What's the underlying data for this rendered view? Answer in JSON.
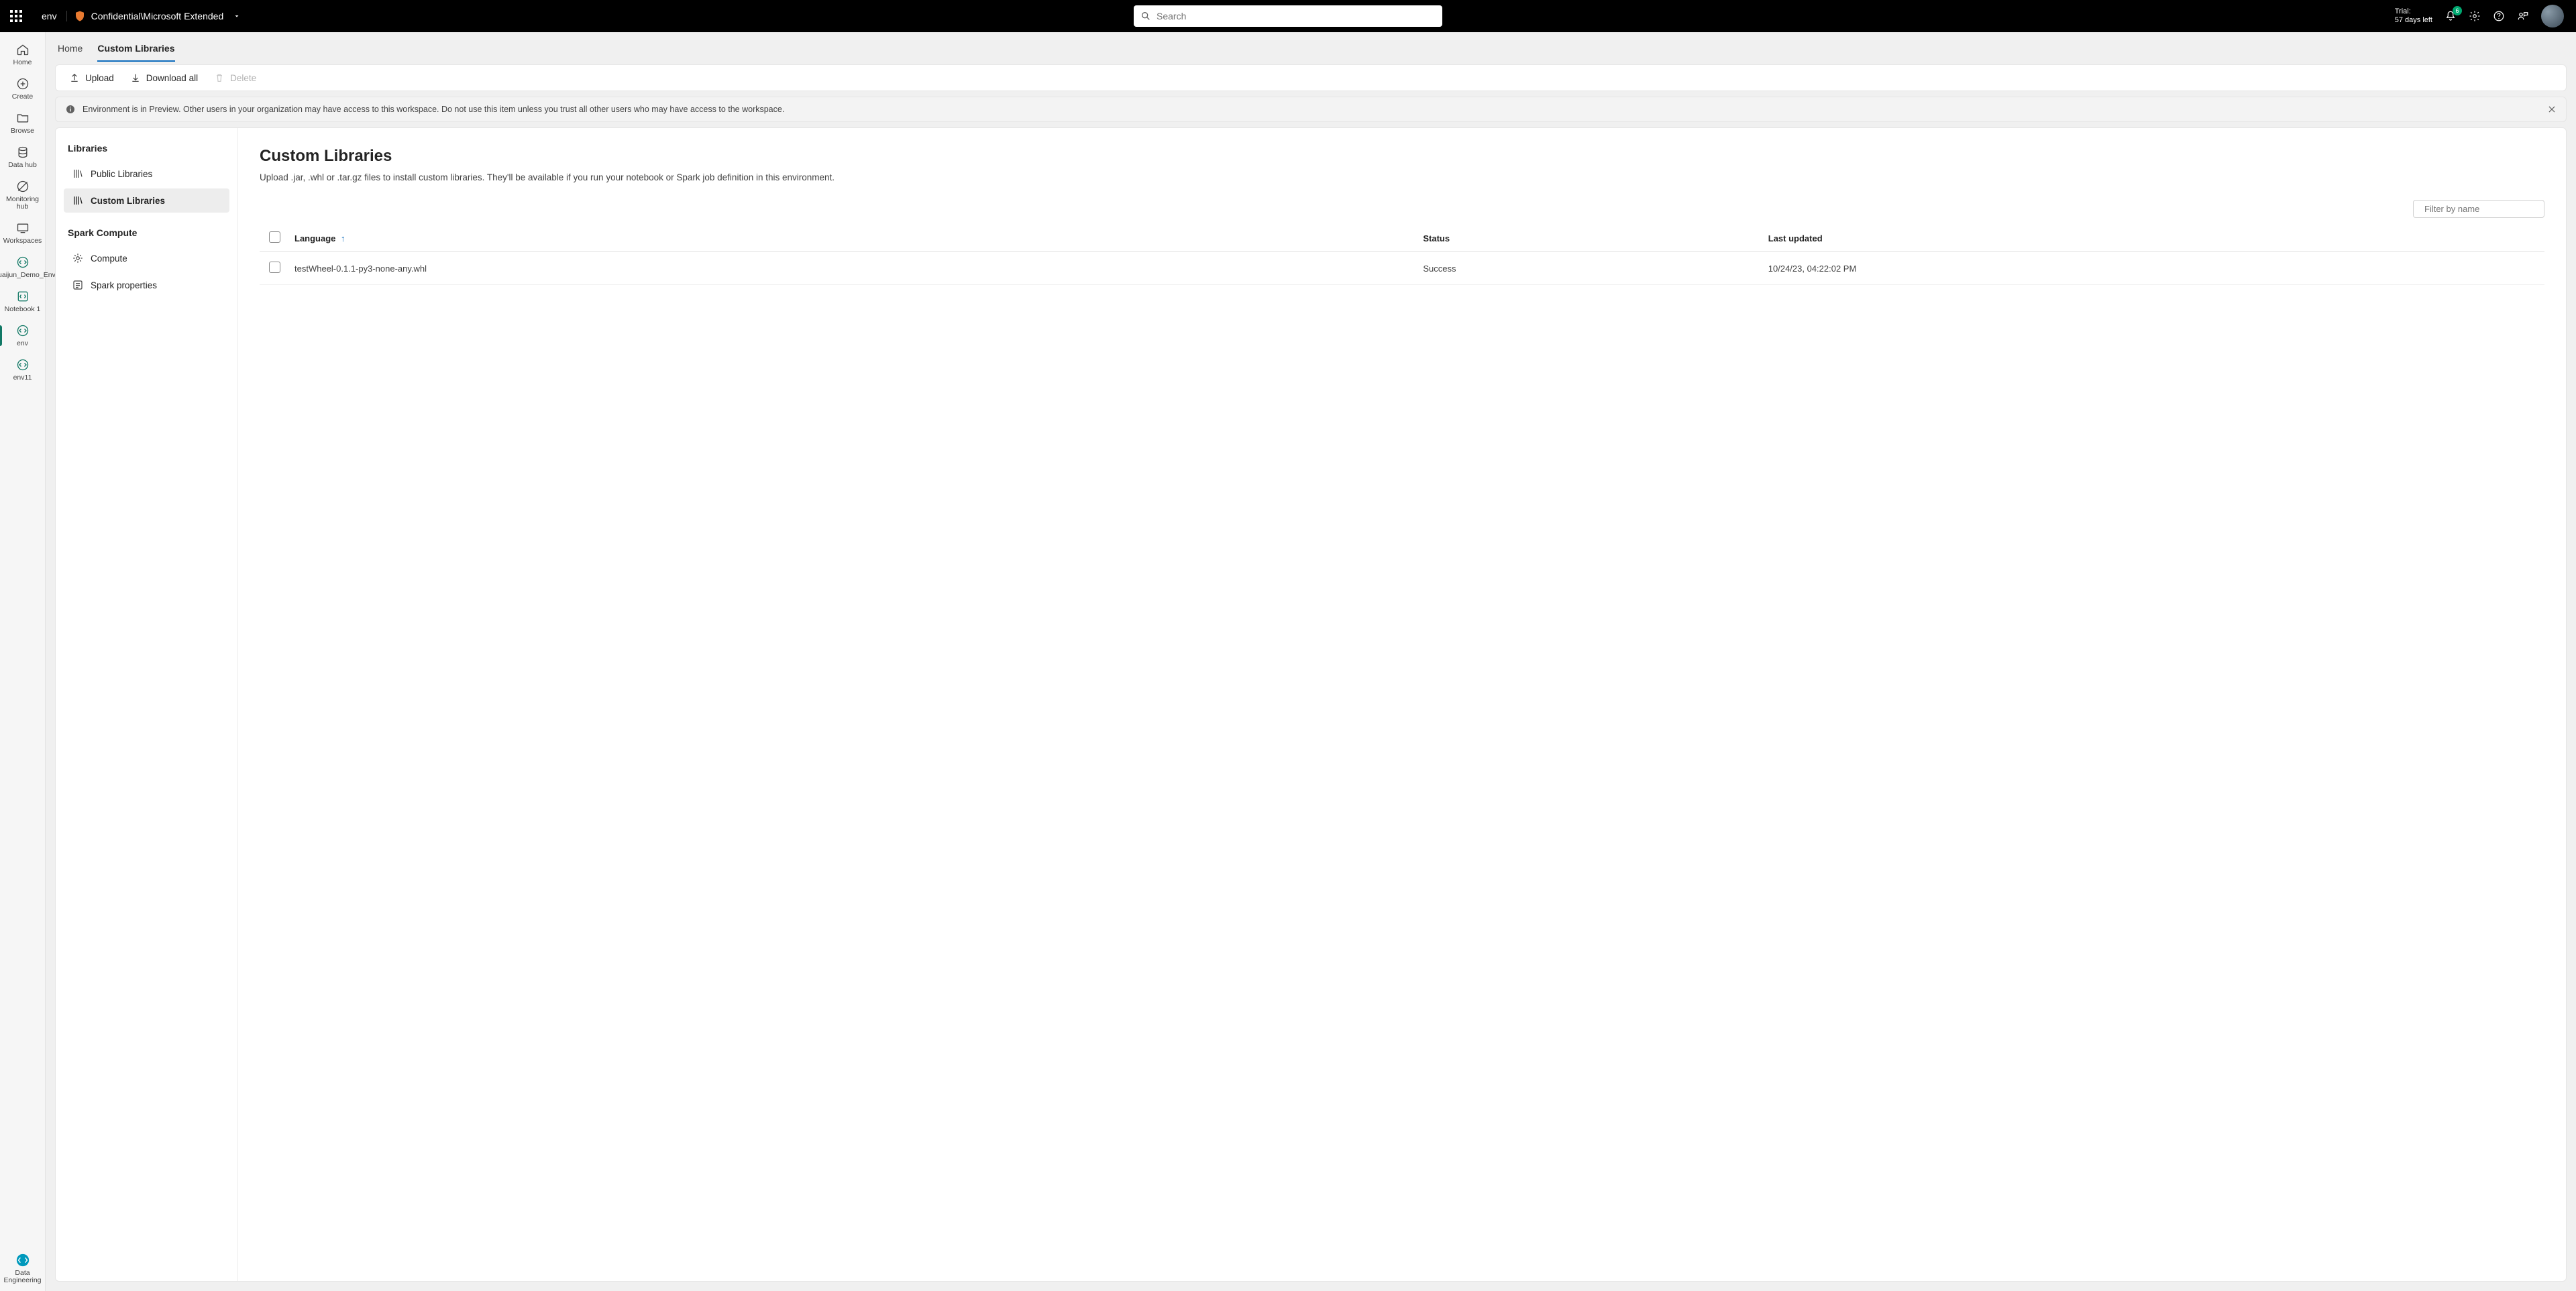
{
  "topbar": {
    "env_label": "env",
    "classification": "Confidential\\Microsoft Extended",
    "search_placeholder": "Search",
    "trial_line1": "Trial:",
    "trial_line2": "57 days left",
    "notification_count": "6"
  },
  "leftrail": {
    "items": [
      {
        "label": "Home",
        "icon": "home"
      },
      {
        "label": "Create",
        "icon": "plus-circle"
      },
      {
        "label": "Browse",
        "icon": "folder"
      },
      {
        "label": "Data hub",
        "icon": "data-hub"
      },
      {
        "label": "Monitoring hub",
        "icon": "monitor"
      },
      {
        "label": "Workspaces",
        "icon": "workspaces"
      },
      {
        "label": "Shuaijun_Demo_Env",
        "icon": "code-circle"
      },
      {
        "label": "Notebook 1",
        "icon": "code-rect"
      },
      {
        "label": "env",
        "icon": "code-circle",
        "selected": true
      },
      {
        "label": "env11",
        "icon": "code-circle"
      }
    ],
    "bottom": {
      "label": "Data Engineering",
      "icon": "data-eng"
    }
  },
  "tabs": [
    {
      "label": "Home",
      "active": false
    },
    {
      "label": "Custom Libraries",
      "active": true
    }
  ],
  "toolbar": {
    "upload": "Upload",
    "download_all": "Download all",
    "delete": "Delete"
  },
  "banner": {
    "text": "Environment is in Preview. Other users in your organization may have access to this workspace. Do not use this item unless you trust all other users who may have access to the workspace."
  },
  "sidenav": {
    "section1": "Libraries",
    "items1": [
      {
        "label": "Public Libraries"
      },
      {
        "label": "Custom Libraries",
        "active": true
      }
    ],
    "section2": "Spark Compute",
    "items2": [
      {
        "label": "Compute"
      },
      {
        "label": "Spark properties"
      }
    ]
  },
  "page": {
    "title": "Custom Libraries",
    "subtitle": "Upload .jar, .whl or .tar.gz files to install custom libraries. They'll be available if you run your notebook or Spark job definition in this environment.",
    "filter_placeholder": "Filter by name"
  },
  "table": {
    "headers": {
      "language": "Language",
      "status": "Status",
      "updated": "Last updated"
    },
    "rows": [
      {
        "language": "testWheel-0.1.1-py3-none-any.whl",
        "status": "Success",
        "updated": "10/24/23, 04:22:02 PM"
      }
    ]
  }
}
